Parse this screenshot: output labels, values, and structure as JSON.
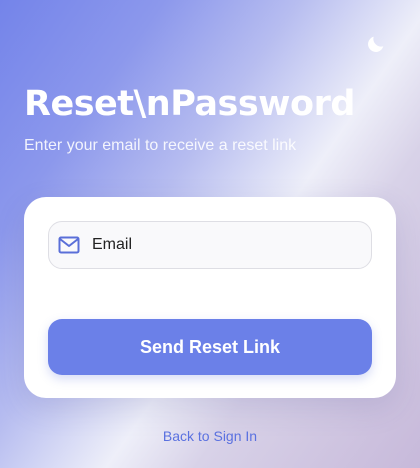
{
  "header": {
    "theme_toggle_icon": "moon-icon",
    "title": "Reset\\nPassword",
    "subtitle": "Enter your email to receive a reset link"
  },
  "form": {
    "email_icon": "mail-icon",
    "email_placeholder": "Email",
    "email_value": "",
    "submit_label": "Send Reset Link"
  },
  "footer": {
    "back_link": "Back to Sign In"
  },
  "colors": {
    "accent": "#6b80e8",
    "link": "#5a71e0",
    "gradient_start": "#7484ea",
    "gradient_end": "#c7b9da"
  }
}
